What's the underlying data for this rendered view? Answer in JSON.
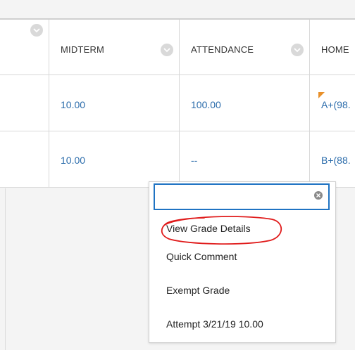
{
  "columns": [
    {
      "label": "",
      "icon": "chevron-down-icon"
    },
    {
      "label": "MIDTERM",
      "icon": "chevron-down-icon"
    },
    {
      "label": "ATTENDANCE",
      "icon": "chevron-down-icon"
    },
    {
      "label": "HOME"
    }
  ],
  "rows": [
    {
      "midterm": "10.00",
      "attendance": "100.00",
      "homework": "A+(98."
    },
    {
      "midterm": "10.00",
      "attendance": "--",
      "homework": "B+(88."
    }
  ],
  "context_menu": {
    "search_value": "",
    "clear_icon": "clear-circle-icon",
    "items": [
      "View Grade Details",
      "Quick Comment",
      "Exempt Grade",
      "Attempt 3/21/19 10.00"
    ]
  },
  "colors": {
    "link": "#2b6cab",
    "focus_border": "#1f73c3",
    "annotation": "#e01b1b",
    "flag": "#e8902a"
  }
}
